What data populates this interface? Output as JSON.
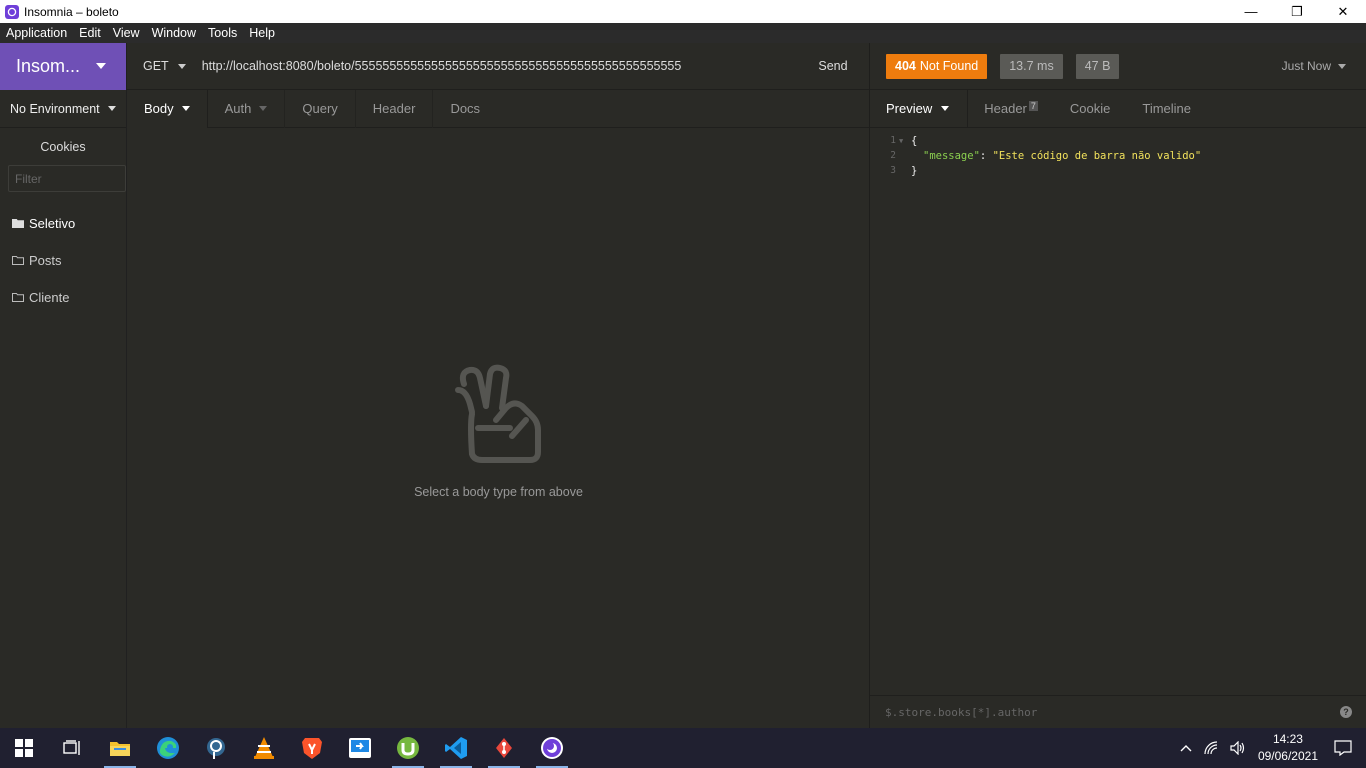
{
  "window": {
    "title": "Insomnia – boleto",
    "minimize": "—",
    "maximize": "❐",
    "close": "✕"
  },
  "menu": [
    "Application",
    "Edit",
    "View",
    "Window",
    "Tools",
    "Help"
  ],
  "sidebar": {
    "workspace": "Insom...",
    "environment": "No Environment",
    "cookies": "Cookies",
    "filter_placeholder": "Filter",
    "folders": [
      {
        "label": "Seletivo",
        "active": true
      },
      {
        "label": "Posts",
        "active": false
      },
      {
        "label": "Cliente",
        "active": false
      }
    ]
  },
  "request": {
    "method": "GET",
    "url": "http://localhost:8080/boleto/55555555555555555555555555555555555555555555555",
    "send": "Send",
    "tabs": [
      "Body",
      "Auth",
      "Query",
      "Header",
      "Docs"
    ],
    "empty_message": "Select a body type from above"
  },
  "response": {
    "status_code": "404",
    "status_text": "Not Found",
    "time": "13.7 ms",
    "size": "47 B",
    "history": "Just Now",
    "tabs": {
      "preview": "Preview",
      "header": "Header",
      "header_count": "7",
      "cookie": "Cookie",
      "timeline": "Timeline"
    },
    "lines": [
      {
        "num": "1",
        "text": "{"
      },
      {
        "num": "2",
        "key": "\"message\"",
        "sep": ": ",
        "value": "\"Este código de barra não valido\""
      },
      {
        "num": "3",
        "text": "}"
      }
    ],
    "filter_placeholder": "$.store.books[*].author",
    "help": "?"
  },
  "taskbar": {
    "time": "14:23",
    "date": "09/06/2021",
    "apps": [
      "windows-start",
      "task-view",
      "file-explorer",
      "edge",
      "postgres",
      "vlc",
      "brave",
      "remote-desktop",
      "utorrent",
      "vscode",
      "git-gui",
      "insomnia"
    ]
  },
  "colors": {
    "accent": "#6f50b6",
    "status_404": "#ee7c0e",
    "json_key": "#8bcf4f",
    "json_string": "#f2e25c"
  }
}
